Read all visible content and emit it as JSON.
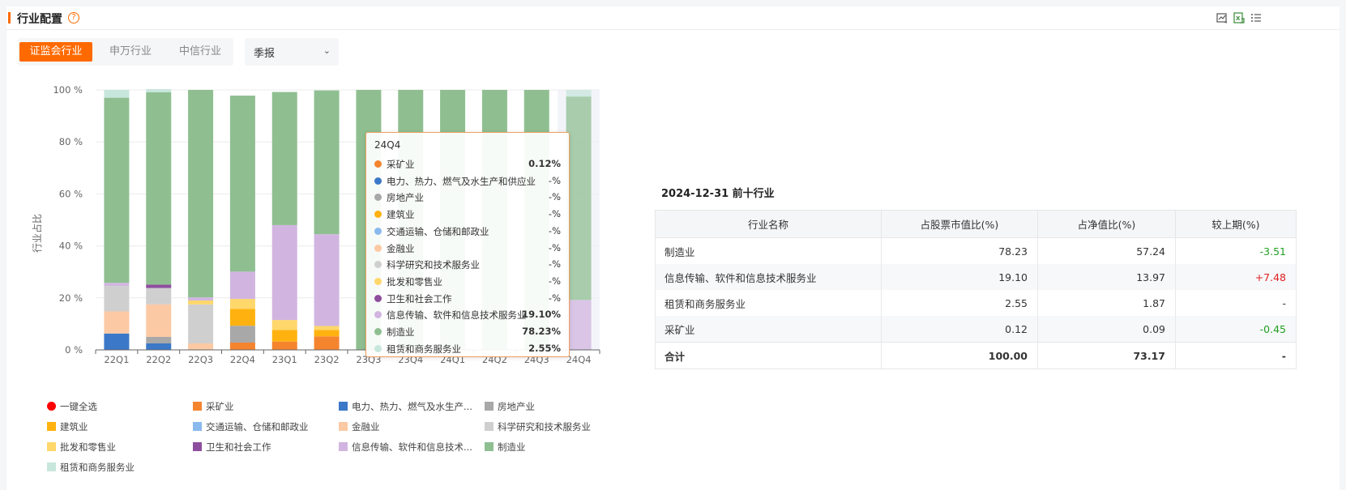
{
  "header": {
    "title": "行业配置",
    "help_icon": "question-circle-icon",
    "tools": [
      "chart-image-icon",
      "excel-export-icon",
      "list-icon"
    ]
  },
  "tabs": [
    {
      "label": "证监会行业",
      "active": true
    },
    {
      "label": "申万行业",
      "active": false
    },
    {
      "label": "中信行业",
      "active": false
    }
  ],
  "period_select": {
    "value": "季报"
  },
  "colors": {
    "accent": "#ff6a00",
    "positive": "#e02020",
    "negative": "#20a020"
  },
  "chart_data": {
    "type": "bar",
    "stacked": true,
    "percent": true,
    "ylabel": "行业占比",
    "ylim": [
      0,
      100
    ],
    "yticks": [
      "0 %",
      "20 %",
      "40 %",
      "60 %",
      "80 %",
      "100 %"
    ],
    "categories": [
      "22Q1",
      "22Q2",
      "22Q3",
      "22Q4",
      "23Q1",
      "23Q2",
      "23Q3",
      "23Q4",
      "24Q1",
      "24Q2",
      "24Q3",
      "24Q4"
    ],
    "series": [
      {
        "name": "采矿业",
        "color": "#f5842f",
        "values": [
          0,
          0,
          0,
          2.8,
          3.2,
          5.2,
          0,
          0,
          0,
          0,
          0,
          0.12
        ]
      },
      {
        "name": "电力、热力、燃气及水生产和供应业",
        "color": "#3b78c8",
        "values": [
          6.3,
          2.5,
          0,
          0,
          0,
          0,
          0,
          0,
          0,
          0,
          0,
          0
        ]
      },
      {
        "name": "房地产业",
        "color": "#a8a8a8",
        "values": [
          0,
          2.5,
          0,
          6.5,
          0,
          0,
          0,
          0,
          0,
          0,
          0,
          0
        ]
      },
      {
        "name": "建筑业",
        "color": "#ffb20f",
        "values": [
          0,
          0,
          0,
          6.5,
          4.5,
          2.5,
          0,
          0,
          0,
          0,
          0,
          0
        ]
      },
      {
        "name": "交通运输、仓储和邮政业",
        "color": "#8ab9ee",
        "values": [
          0,
          0,
          0,
          0,
          0,
          0,
          0,
          0,
          0,
          0,
          0,
          0
        ]
      },
      {
        "name": "金融业",
        "color": "#fbc9a3",
        "values": [
          8.5,
          12.5,
          2.5,
          0,
          0,
          0,
          0,
          0,
          0,
          0,
          0,
          0
        ]
      },
      {
        "name": "科学研究和技术服务业",
        "color": "#cfcfcf",
        "values": [
          9.8,
          6.3,
          15,
          0,
          0,
          0,
          0,
          0,
          0,
          0,
          0,
          0
        ]
      },
      {
        "name": "批发和零售业",
        "color": "#ffd76b",
        "values": [
          0,
          0,
          1.5,
          3.8,
          3.8,
          1.5,
          0,
          0,
          0,
          0,
          0,
          0
        ]
      },
      {
        "name": "卫生和社会工作",
        "color": "#8e4e9e",
        "values": [
          0,
          1.3,
          0,
          0,
          0,
          0,
          0,
          0,
          0,
          0,
          0,
          0
        ]
      },
      {
        "name": "信息传输、软件和信息技术服务业",
        "color": "#d1b5e0",
        "values": [
          1.2,
          0,
          1.2,
          10.5,
          36.5,
          35.3,
          0,
          0,
          0,
          0,
          0,
          19.1
        ]
      },
      {
        "name": "制造业",
        "color": "#8fbf91",
        "values": [
          71.2,
          74,
          79.8,
          67.7,
          51.2,
          55.3,
          100,
          100,
          100,
          100,
          100,
          78.23
        ]
      },
      {
        "name": "租赁和商务服务业",
        "color": "#c7e6dc",
        "values": [
          3,
          1.2,
          0,
          0,
          0,
          0,
          0,
          0,
          0,
          0,
          0,
          2.55
        ]
      }
    ]
  },
  "tooltip": {
    "title": "24Q4",
    "rows": [
      {
        "name": "采矿业",
        "value": "0.12%",
        "bold": true
      },
      {
        "name": "电力、热力、燃气及水生产和供应业",
        "value": "-%",
        "bold": false
      },
      {
        "name": "房地产业",
        "value": "-%",
        "bold": false
      },
      {
        "name": "建筑业",
        "value": "-%",
        "bold": false
      },
      {
        "name": "交通运输、仓储和邮政业",
        "value": "-%",
        "bold": false
      },
      {
        "name": "金融业",
        "value": "-%",
        "bold": false
      },
      {
        "name": "科学研究和技术服务业",
        "value": "-%",
        "bold": false
      },
      {
        "name": "批发和零售业",
        "value": "-%",
        "bold": false
      },
      {
        "name": "卫生和社会工作",
        "value": "-%",
        "bold": false
      },
      {
        "name": "信息传输、软件和信息技术服务业",
        "value": "19.10%",
        "bold": true
      },
      {
        "name": "制造业",
        "value": "78.23%",
        "bold": true
      },
      {
        "name": "租赁和商务服务业",
        "value": "2.55%",
        "bold": true
      }
    ]
  },
  "legend": {
    "select_all": {
      "label": "一键全选",
      "color": "#ff0000"
    },
    "items": [
      "采矿业",
      "电力、热力、燃气及水生产...",
      "房地产业",
      "建筑业",
      "交通运输、仓储和邮政业",
      "金融业",
      "科学研究和技术服务业",
      "批发和零售业",
      "卫生和社会工作",
      "信息传输、软件和信息技术...",
      "制造业",
      "租赁和商务服务业"
    ]
  },
  "top10": {
    "title": "2024-12-31 前十行业",
    "headers": [
      "行业名称",
      "占股票市值比(%)",
      "占净值比(%)",
      "较上期(%)"
    ],
    "rows": [
      {
        "name": "制造业",
        "stock_pct": "78.23",
        "nav_pct": "57.24",
        "change": "-3.51",
        "trend": "neg"
      },
      {
        "name": "信息传输、软件和信息技术服务业",
        "stock_pct": "19.10",
        "nav_pct": "13.97",
        "change": "+7.48",
        "trend": "pos"
      },
      {
        "name": "租赁和商务服务业",
        "stock_pct": "2.55",
        "nav_pct": "1.87",
        "change": "-",
        "trend": "none"
      },
      {
        "name": "采矿业",
        "stock_pct": "0.12",
        "nav_pct": "0.09",
        "change": "-0.45",
        "trend": "neg"
      }
    ],
    "total": {
      "name": "合计",
      "stock_pct": "100.00",
      "nav_pct": "73.17",
      "change": "-"
    }
  }
}
